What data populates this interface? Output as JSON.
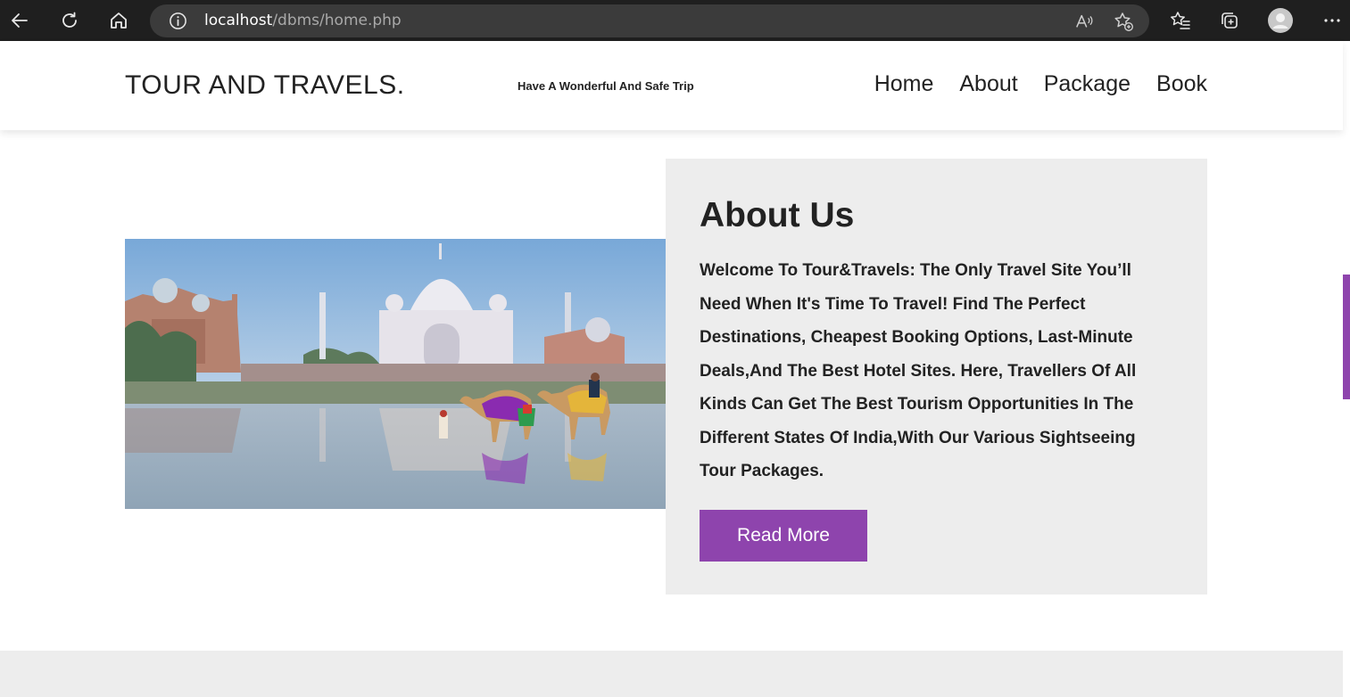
{
  "browser": {
    "url_host": "localhost",
    "url_path": "/dbms/home.php"
  },
  "header": {
    "logo": "TOUR AND TRAVELS.",
    "tagline": "Have A Wonderful And Safe Trip",
    "nav": [
      "Home",
      "About",
      "Package",
      "Book"
    ]
  },
  "about": {
    "title": "About Us",
    "text": "Welcome To Tour&Travels: The Only Travel Site You’ll Need When It's Time To Travel! Find The Perfect Destinations, Cheapest Booking Options, Last-Minute Deals,And The Best Hotel Sites. Here, Travellers Of All Kinds Can Get The Best Tourism Opportunities In The Different States Of India,With Our Various Sightseeing Tour Packages.",
    "button": "Read More"
  },
  "colors": {
    "accent": "#8e44ad",
    "panel": "#ededed",
    "browser_bar": "#1f1f1f"
  }
}
